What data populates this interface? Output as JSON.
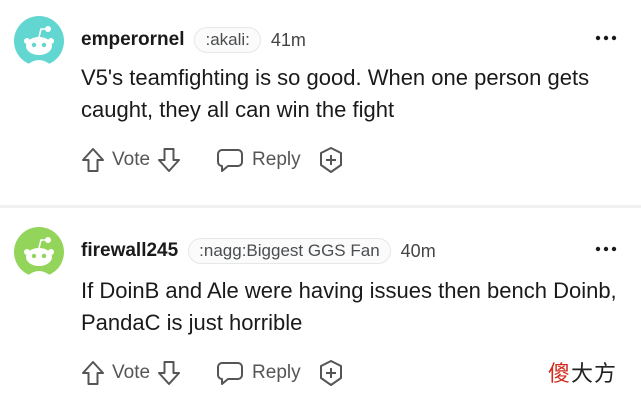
{
  "comments": [
    {
      "username": "emperornel",
      "flair": ":akali:",
      "time": "41m",
      "body": "V5's teamfighting is so good. When one person gets caught, they all can win the fight",
      "vote_label": "Vote",
      "reply_label": "Reply",
      "avatar_color": "#62d6d0"
    },
    {
      "username": "firewall245",
      "flair": ":nagg:Biggest GGS Fan",
      "time": "40m",
      "body": "If DoinB and Ale were having issues then bench Doinb, PandaC is just horrible",
      "vote_label": "Vote",
      "reply_label": "Reply",
      "avatar_color": "#93d45b"
    }
  ],
  "watermark": {
    "brand_accent": "傻",
    "brand_rest": "大方"
  },
  "colors": {
    "text": "#1a1a1b",
    "muted": "#555555",
    "divider": "#eef0f1",
    "brand_red": "#d12b1e"
  }
}
